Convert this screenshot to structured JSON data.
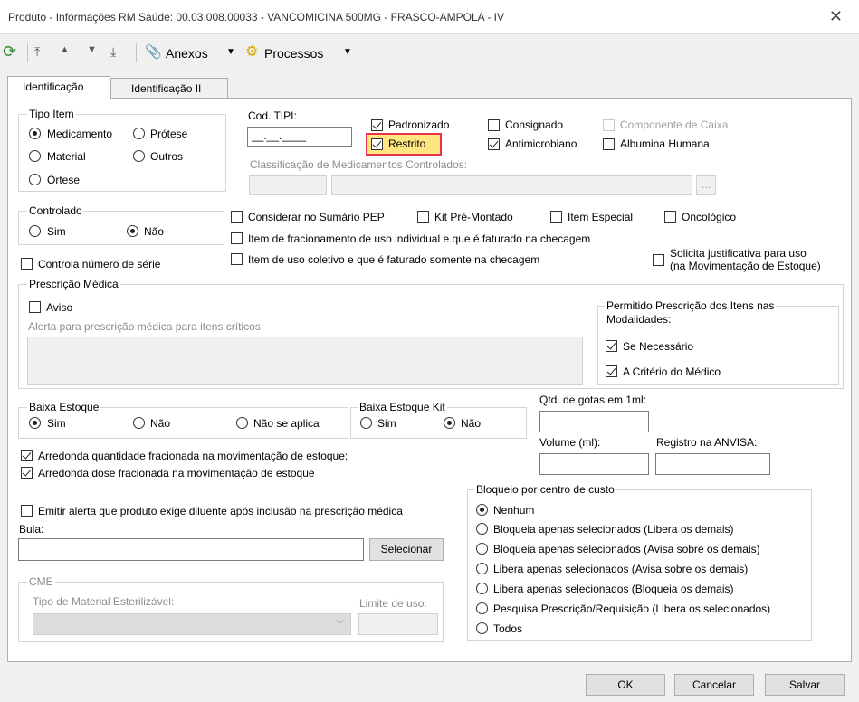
{
  "window": {
    "title": "Produto - Informações RM Saúde: 00.03.008.00033 - VANCOMICINA 500MG - FRASCO-AMPOLA - IV"
  },
  "toolbar": {
    "anexos": "Anexos",
    "processos": "Processos"
  },
  "tabs": [
    "Identificação",
    "Identificação II"
  ],
  "tipo_item": {
    "legend": "Tipo Item",
    "options": [
      "Medicamento",
      "Prótese",
      "Material",
      "Outros",
      "Órtese"
    ],
    "selected": "Medicamento"
  },
  "cod_tipi": {
    "label": "Cod. TIPI:",
    "value": "__.__.____"
  },
  "flags": {
    "padronizado": "Padronizado",
    "consignado": "Consignado",
    "componente_caixa": "Componente de Caixa",
    "restrito": "Restrito",
    "antimicrobiano": "Antimicrobiano",
    "albumina": "Albumina Humana"
  },
  "classificacao": {
    "label": "Classificação de Medicamentos Controlados:",
    "browse": "..."
  },
  "controlado": {
    "legend": "Controlado",
    "sim": "Sim",
    "nao": "Não"
  },
  "options_row": {
    "considerar_sumario": "Considerar no Sumário PEP",
    "kit_pre_montado": "Kit Pré-Montado",
    "item_especial": "Item Especial",
    "oncologico": "Oncológico",
    "item_fracionamento": "Item de fracionamento de uso individual e que é faturado na checagem",
    "item_uso_coletivo": "Item de uso coletivo e que é faturado somente na checagem",
    "controla_numero_serie": "Controla número de série",
    "solicita_justificativa_1": "Solicita justificativa para uso",
    "solicita_justificativa_2": "(na Movimentação de Estoque)"
  },
  "prescricao": {
    "legend": "Prescrição Médica",
    "aviso": "Aviso",
    "alerta_label": "Alerta para prescrição médica para itens críticos:",
    "permitido_legend_1": "Permitido Prescrição dos Itens nas",
    "permitido_legend_2": "Modalidades:",
    "se_necessario": "Se Necessário",
    "criterio_medico": "A Critério do Médico"
  },
  "baixa_estoque": {
    "legend": "Baixa Estoque",
    "sim": "Sim",
    "nao": "Não",
    "nao_aplica": "Não se aplica"
  },
  "baixa_estoque_kit": {
    "legend": "Baixa Estoque Kit",
    "sim": "Sim",
    "nao": "Não"
  },
  "qtd_gotas": {
    "label": "Qtd. de gotas em 1ml:"
  },
  "volume": {
    "label": "Volume (ml):"
  },
  "registro_anvisa": {
    "label": "Registro na ANVISA:"
  },
  "arredonda_qtd": "Arredonda quantidade fracionada na movimentação de estoque:",
  "arredonda_dose": "Arredonda dose fracionada na movimentação de estoque",
  "emitir_alerta": "Emitir alerta que produto exige diluente após inclusão na prescrição médica",
  "bula": {
    "label": "Bula:",
    "button": "Selecionar"
  },
  "bloqueio": {
    "legend": "Bloqueio por centro de custo",
    "options": [
      "Nenhum",
      "Bloqueia apenas selecionados (Libera os demais)",
      "Bloqueia apenas selecionados (Avisa sobre os demais)",
      "Libera apenas selecionados (Avisa sobre os demais)",
      "Libera apenas selecionados (Bloqueia os demais)",
      "Pesquisa Prescrição/Requisição (Libera os selecionados)",
      "Todos"
    ]
  },
  "cme": {
    "legend": "CME",
    "tipo_label": "Tipo de Material Esterilizável:",
    "limite_label": "Limite de uso:"
  },
  "footer": {
    "ok": "OK",
    "cancelar": "Cancelar",
    "salvar": "Salvar"
  },
  "colors": {
    "highlight": "#e8344a",
    "highlight_bg": "#ffe680"
  }
}
